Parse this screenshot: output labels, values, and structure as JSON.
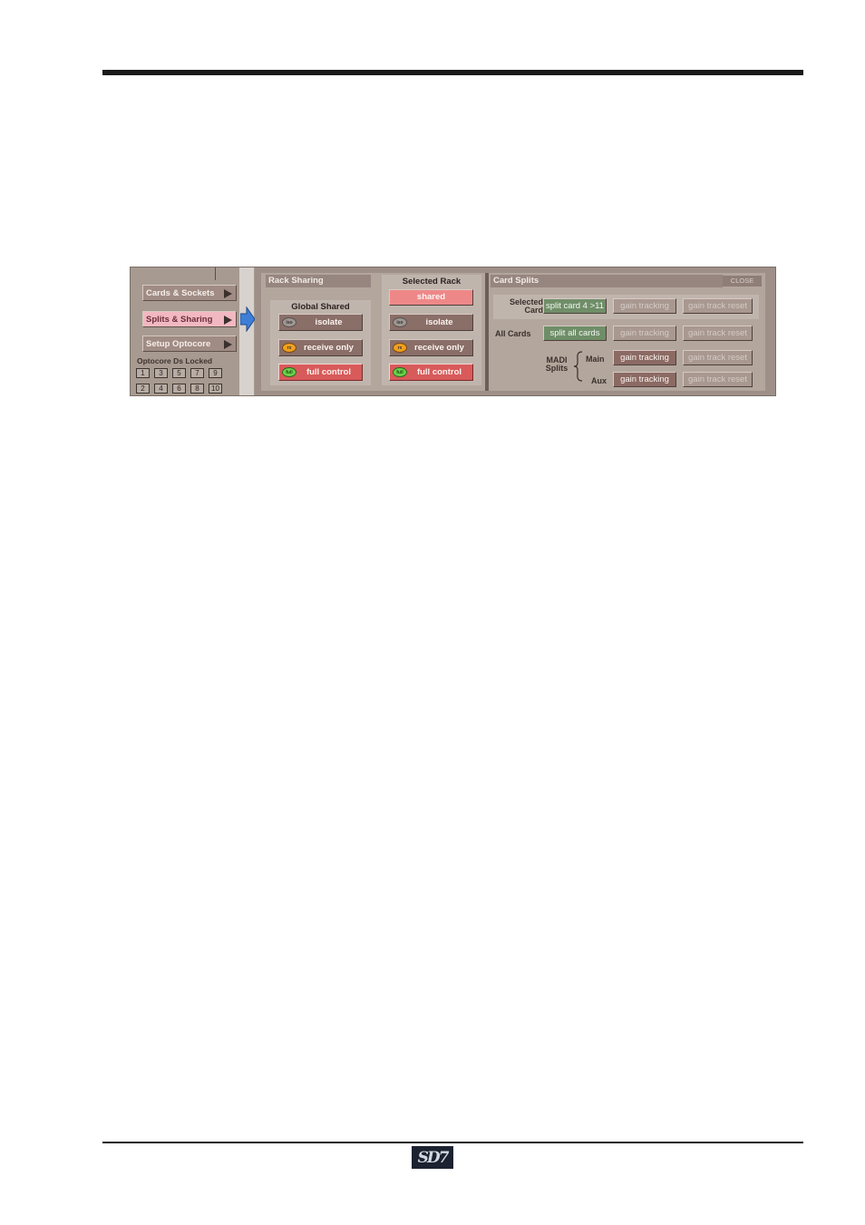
{
  "page": {
    "logo_text": "SD7"
  },
  "nav": {
    "items": [
      {
        "label": "Cards & Sockets"
      },
      {
        "label": "Splits & Sharing"
      },
      {
        "label": "Setup Optocore"
      }
    ],
    "optocore_label": "Optocore Ds Locked",
    "optocore_boxes": [
      "1",
      "3",
      "5",
      "7",
      "9",
      "2",
      "4",
      "6",
      "8",
      "10"
    ]
  },
  "rack_sharing": {
    "header": "Rack Sharing",
    "global_title": "Global Shared",
    "global_buttons": [
      {
        "label": "isolate",
        "led": "iso"
      },
      {
        "label": "receive only",
        "led": "rx"
      },
      {
        "label": "full control",
        "led": "full"
      }
    ],
    "selected_title": "Selected Rack",
    "selected_state": "shared",
    "selected_buttons": [
      {
        "label": "isolate",
        "led": "iso"
      },
      {
        "label": "receive only",
        "led": "rx"
      },
      {
        "label": "full control",
        "led": "full"
      }
    ]
  },
  "card_splits": {
    "header": "Card Splits",
    "close_label": "CLOSE",
    "selected_card_label": "Selected Card",
    "split_card_label": "split card 4 >11",
    "all_cards_label": "All Cards",
    "split_all_label": "split all cards",
    "gain_tracking_label": "gain tracking",
    "gain_track_reset_label": "gain track reset",
    "madi_label": "MADI Splits",
    "main_label": "Main",
    "aux_label": "Aux"
  },
  "colors": {
    "panel": "#a89c92",
    "active_red": "#d85a5a",
    "split_green": "#6f8e68"
  }
}
